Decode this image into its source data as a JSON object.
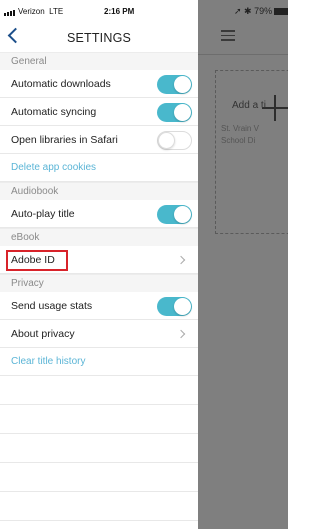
{
  "status_bar": {
    "carrier": "Verizon",
    "network": "LTE",
    "time": "2:16 PM"
  },
  "bg_app": {
    "status": "79%",
    "add_text": "Add a ti",
    "library_line1": "St. Vrain V",
    "library_line2": "School Di"
  },
  "nav": {
    "title": "SETTINGS"
  },
  "sections": {
    "general": "General",
    "audiobook": "Audiobook",
    "ebook": "eBook",
    "privacy": "Privacy"
  },
  "rows": {
    "automatic_downloads": {
      "label": "Automatic downloads",
      "on": true
    },
    "automatic_syncing": {
      "label": "Automatic syncing",
      "on": true
    },
    "open_libraries_safari": {
      "label": "Open libraries in Safari",
      "on": false
    },
    "delete_cookies": {
      "label": "Delete app cookies"
    },
    "auto_play": {
      "label": "Auto-play title",
      "on": true
    },
    "adobe_id": {
      "label": "Adobe ID"
    },
    "send_usage": {
      "label": "Send usage stats",
      "on": true
    },
    "about_privacy": {
      "label": "About privacy"
    },
    "clear_history": {
      "label": "Clear title history"
    }
  },
  "colors": {
    "accent": "#49b8cc",
    "link": "#5bb5d6",
    "back": "#1c4f8a",
    "highlight": "#d8232a"
  }
}
